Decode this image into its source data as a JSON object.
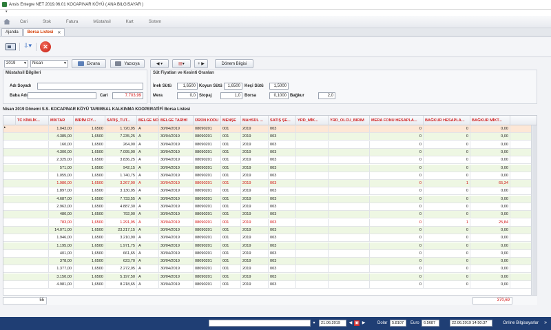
{
  "window": {
    "title": "Ansis Entegre NET 2019.06.01 KOCAPINAR KÖYÜ ( ANA BILGISAYAR )"
  },
  "menu": [
    "Cari",
    "Stok",
    "Fatura",
    "Müstahsil",
    "Kart",
    "Sistem"
  ],
  "tabs": [
    {
      "label": "Ajanda",
      "active": false
    },
    {
      "label": "Borsa Listesi",
      "active": true
    }
  ],
  "filter": {
    "year": "2019",
    "month": "Nisan",
    "ekrana_label": "Ekrana",
    "yaziciya_label": "Yazıcıya",
    "donem_label": "Dönem Bilgisi"
  },
  "mustahsil": {
    "title": "Müstahsil Bilgileri",
    "adi_soyadi_label": "Adı Soyadı",
    "adi_soyadi": "",
    "baba_adi_label": "Baba Adı",
    "baba_adi": "",
    "cari_label": "Cari",
    "cari": "7.703,99"
  },
  "fiyatlar": {
    "title": "Süt Fiyatları ve Kesinti Oranları",
    "inek_sutu_label": "İnek Sütü",
    "inek_sutu": "1,6500",
    "koyun_sutu_label": "Koyun Sütü",
    "koyun_sutu": "1,6500",
    "keci_sutu_label": "Keçi Sütü",
    "keci_sutu": "1,5000",
    "mera_label": "Mera",
    "mera": "0,0",
    "stopaj_label": "Stopaj",
    "stopaj": "1,0",
    "borsa_label": "Borsa",
    "borsa": "0,1000",
    "bagkur_label": "Bağkur",
    "bagkur": "2,0"
  },
  "section_title": "Nisan 2019 Dönemi S.S. KOCAPINAR KÖYÜ TARIMSAL KALKINMA KOOPERATİFİ Borsa Listesi",
  "table": {
    "columns": [
      "TC KİMLİK...",
      "MİKTAR",
      "BİRİM FİY...",
      "SATIŞ_TUT...",
      "BELGE NO",
      "BELGE TARİHİ",
      "ÜRÜN KODU",
      "MENŞE",
      "MAHSÜL ...",
      "SATIŞ ŞE...",
      "YRD_MİK...",
      "YRD_OLCU_BIRIM",
      "MERA FONU HESAPLA...",
      "BAĞKUR HESAPLA...",
      "BAĞKUR MİKT..."
    ],
    "rows": [
      {
        "miktar": "1.043,00",
        "birim": "1,6500",
        "satis": "1.720,95",
        "belge_no": "A",
        "tarih": "30/04/2019",
        "urun": "08090201",
        "mense": "001",
        "mahsul": "2019",
        "sekli": "003",
        "mera": "0",
        "bagkur_h": "0",
        "bagkur_m": "0,00",
        "red": false
      },
      {
        "miktar": "4.385,00",
        "birim": "1,6500",
        "satis": "7.235,25",
        "belge_no": "A",
        "tarih": "30/04/2019",
        "urun": "08090201",
        "mense": "001",
        "mahsul": "2019",
        "sekli": "003",
        "mera": "0",
        "bagkur_h": "0",
        "bagkur_m": "0,00",
        "red": false
      },
      {
        "miktar": "160,00",
        "birim": "1,6500",
        "satis": "264,00",
        "belge_no": "A",
        "tarih": "30/04/2019",
        "urun": "08090201",
        "mense": "001",
        "mahsul": "2019",
        "sekli": "003",
        "mera": "0",
        "bagkur_h": "0",
        "bagkur_m": "0,00",
        "red": false
      },
      {
        "miktar": "4.300,00",
        "birim": "1,6500",
        "satis": "7.095,00",
        "belge_no": "A",
        "tarih": "30/04/2019",
        "urun": "08090201",
        "mense": "001",
        "mahsul": "2019",
        "sekli": "003",
        "mera": "0",
        "bagkur_h": "0",
        "bagkur_m": "0,00",
        "red": false
      },
      {
        "miktar": "2.325,00",
        "birim": "1,6500",
        "satis": "3.836,25",
        "belge_no": "A",
        "tarih": "30/04/2019",
        "urun": "08090201",
        "mense": "001",
        "mahsul": "2019",
        "sekli": "003",
        "mera": "0",
        "bagkur_h": "0",
        "bagkur_m": "0,00",
        "red": false
      },
      {
        "miktar": "571,00",
        "birim": "1,6500",
        "satis": "942,15",
        "belge_no": "A",
        "tarih": "30/04/2019",
        "urun": "08090201",
        "mense": "001",
        "mahsul": "2019",
        "sekli": "003",
        "mera": "0",
        "bagkur_h": "0",
        "bagkur_m": "0,00",
        "red": false
      },
      {
        "miktar": "1.055,00",
        "birim": "1,6500",
        "satis": "1.740,75",
        "belge_no": "A",
        "tarih": "30/04/2019",
        "urun": "08090201",
        "mense": "001",
        "mahsul": "2019",
        "sekli": "003",
        "mera": "0",
        "bagkur_h": "0",
        "bagkur_m": "0,00",
        "red": false
      },
      {
        "miktar": "1.980,00",
        "birim": "1,6500",
        "satis": "3.267,00",
        "belge_no": "A",
        "tarih": "30/04/2019",
        "urun": "08090201",
        "mense": "001",
        "mahsul": "2019",
        "sekli": "003",
        "mera": "0",
        "bagkur_h": "1",
        "bagkur_m": "65,34",
        "red": true
      },
      {
        "miktar": "1.897,00",
        "birim": "1,6500",
        "satis": "3.130,05",
        "belge_no": "A",
        "tarih": "30/04/2019",
        "urun": "08090201",
        "mense": "001",
        "mahsul": "2019",
        "sekli": "003",
        "mera": "0",
        "bagkur_h": "0",
        "bagkur_m": "0,00",
        "red": false
      },
      {
        "miktar": "4.687,00",
        "birim": "1,6500",
        "satis": "7.733,55",
        "belge_no": "A",
        "tarih": "30/04/2019",
        "urun": "08090201",
        "mense": "001",
        "mahsul": "2019",
        "sekli": "003",
        "mera": "0",
        "bagkur_h": "0",
        "bagkur_m": "0,00",
        "red": false
      },
      {
        "miktar": "2.962,00",
        "birim": "1,6500",
        "satis": "4.887,30",
        "belge_no": "A",
        "tarih": "30/04/2019",
        "urun": "08090201",
        "mense": "001",
        "mahsul": "2019",
        "sekli": "003",
        "mera": "0",
        "bagkur_h": "0",
        "bagkur_m": "0,00",
        "red": false
      },
      {
        "miktar": "480,00",
        "birim": "1,6500",
        "satis": "792,00",
        "belge_no": "A",
        "tarih": "30/04/2019",
        "urun": "08090201",
        "mense": "001",
        "mahsul": "2019",
        "sekli": "003",
        "mera": "0",
        "bagkur_h": "0",
        "bagkur_m": "0,00",
        "red": false
      },
      {
        "miktar": "783,00",
        "birim": "1,6500",
        "satis": "1.291,95",
        "belge_no": "A",
        "tarih": "30/04/2019",
        "urun": "08090201",
        "mense": "001",
        "mahsul": "2019",
        "sekli": "003",
        "mera": "0",
        "bagkur_h": "1",
        "bagkur_m": "25,84",
        "red": true
      },
      {
        "miktar": "14.071,00",
        "birim": "1,6500",
        "satis": "23.217,15",
        "belge_no": "A",
        "tarih": "30/04/2019",
        "urun": "08090201",
        "mense": "001",
        "mahsul": "2019",
        "sekli": "003",
        "mera": "0",
        "bagkur_h": "0",
        "bagkur_m": "0,00",
        "red": false
      },
      {
        "miktar": "1.946,00",
        "birim": "1,6500",
        "satis": "3.210,90",
        "belge_no": "A",
        "tarih": "30/04/2019",
        "urun": "08090201",
        "mense": "001",
        "mahsul": "2019",
        "sekli": "003",
        "mera": "0",
        "bagkur_h": "0",
        "bagkur_m": "0,00",
        "red": false
      },
      {
        "miktar": "1.195,00",
        "birim": "1,6500",
        "satis": "1.971,75",
        "belge_no": "A",
        "tarih": "30/04/2019",
        "urun": "08090201",
        "mense": "001",
        "mahsul": "2019",
        "sekli": "003",
        "mera": "0",
        "bagkur_h": "0",
        "bagkur_m": "0,00",
        "red": false
      },
      {
        "miktar": "401,00",
        "birim": "1,6500",
        "satis": "661,65",
        "belge_no": "A",
        "tarih": "30/04/2019",
        "urun": "08090201",
        "mense": "001",
        "mahsul": "2019",
        "sekli": "003",
        "mera": "0",
        "bagkur_h": "0",
        "bagkur_m": "0,00",
        "red": false
      },
      {
        "miktar": "378,00",
        "birim": "1,6500",
        "satis": "623,70",
        "belge_no": "A",
        "tarih": "30/04/2019",
        "urun": "08090201",
        "mense": "001",
        "mahsul": "2019",
        "sekli": "003",
        "mera": "0",
        "bagkur_h": "0",
        "bagkur_m": "0,00",
        "red": false
      },
      {
        "miktar": "1.377,00",
        "birim": "1,6500",
        "satis": "2.272,05",
        "belge_no": "A",
        "tarih": "30/04/2019",
        "urun": "08090201",
        "mense": "001",
        "mahsul": "2019",
        "sekli": "003",
        "mera": "0",
        "bagkur_h": "0",
        "bagkur_m": "0,00",
        "red": false
      },
      {
        "miktar": "3.150,00",
        "birim": "1,6500",
        "satis": "5.197,50",
        "belge_no": "A",
        "tarih": "30/04/2019",
        "urun": "08090201",
        "mense": "001",
        "mahsul": "2019",
        "sekli": "003",
        "mera": "0",
        "bagkur_h": "0",
        "bagkur_m": "0,00",
        "red": false
      },
      {
        "miktar": "4.981,00",
        "birim": "1,6500",
        "satis": "8.218,65",
        "belge_no": "A",
        "tarih": "30/04/2019",
        "urun": "08090201",
        "mense": "001",
        "mahsul": "2019",
        "sekli": "003",
        "mera": "0",
        "bagkur_h": "0",
        "bagkur_m": "0,00",
        "red": false
      }
    ],
    "footer_count": "55",
    "footer_total": "370,69"
  },
  "statusbar": {
    "date1": "21.06.2019",
    "dolar_label": "Dolar",
    "dolar": "5.8107",
    "euro_label": "Euro",
    "euro": "6.5687",
    "datetime": "22.06.2019 14:50:37",
    "online": "Online Bilgisayarlar"
  }
}
